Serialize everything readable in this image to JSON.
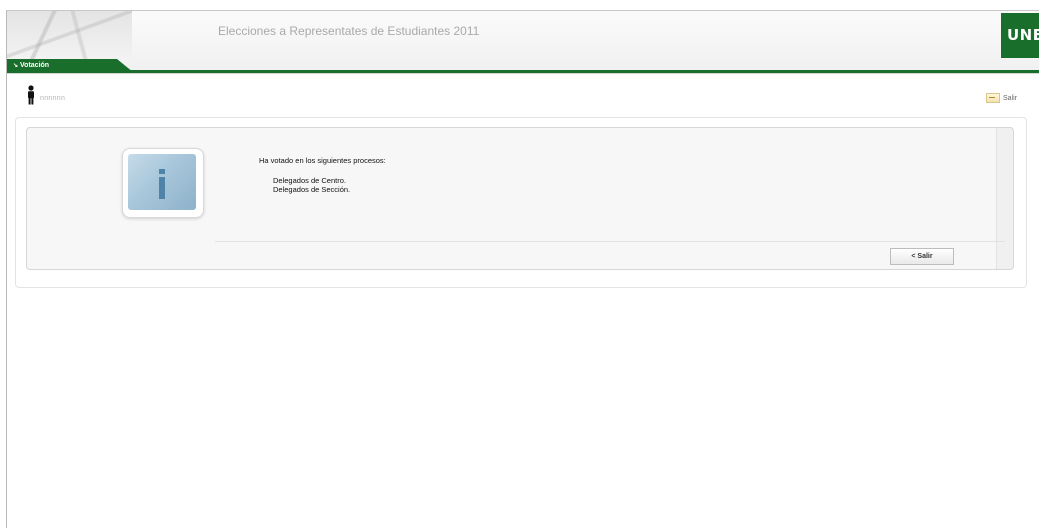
{
  "header": {
    "app_title": "Elecciones a Representates de Estudiantes 2011",
    "tab_label": "Votación",
    "logo_text": "UNED"
  },
  "userbar": {
    "user_name": "nnnnnn",
    "logout_label": "Salir"
  },
  "message": {
    "heading": "Ha votado en los siguientes procesos:",
    "processes": [
      "Delegados de Centro.",
      "Delegados de Sección."
    ],
    "exit_button": "< Salir"
  },
  "icons": {
    "tab_arrow": "arrow-icon",
    "user": "user-icon",
    "logout": "exit-door-icon",
    "info": "info-icon"
  },
  "colors": {
    "brand_green": "#1a6e2c",
    "info_tile": "#a8c6da",
    "info_glyph": "#4f83a8"
  }
}
